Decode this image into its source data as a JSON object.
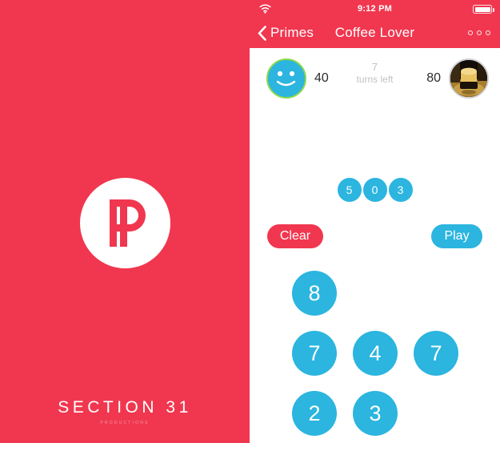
{
  "splash": {
    "background_color": "#F0374F",
    "logo_icon": "pp-monogram-logo",
    "brand_name": "SECTION 31",
    "brand_subtitle": "PRODUCTIONS"
  },
  "app": {
    "status_bar": {
      "wifi_icon": "wifi-icon",
      "time": "9:12 PM",
      "battery_icon": "battery-full-icon"
    },
    "nav_bar": {
      "back_icon": "chevron-left-icon",
      "back_label": "Primes",
      "title": "Coffee Lover",
      "more_icon": "more-options-icon"
    },
    "scoreboard": {
      "player_left": {
        "avatar_icon": "smiley-face-avatar",
        "score": "40"
      },
      "turns": {
        "count": "7",
        "label": "turns left"
      },
      "player_right": {
        "avatar_icon": "coffee-cup-avatar",
        "score": "80"
      }
    },
    "played_tiles": [
      "5",
      "0",
      "3"
    ],
    "buttons": {
      "clear": "Clear",
      "play": "Play"
    },
    "keypad_rows": [
      [
        "8"
      ],
      [
        "7",
        "4",
        "7"
      ],
      [
        "2",
        "3"
      ]
    ],
    "colors": {
      "accent_red": "#F0374F",
      "accent_cyan": "#2BB5DF",
      "avatar_ring_green": "#8BD94B",
      "muted_gray": "#C2C2C6"
    }
  }
}
